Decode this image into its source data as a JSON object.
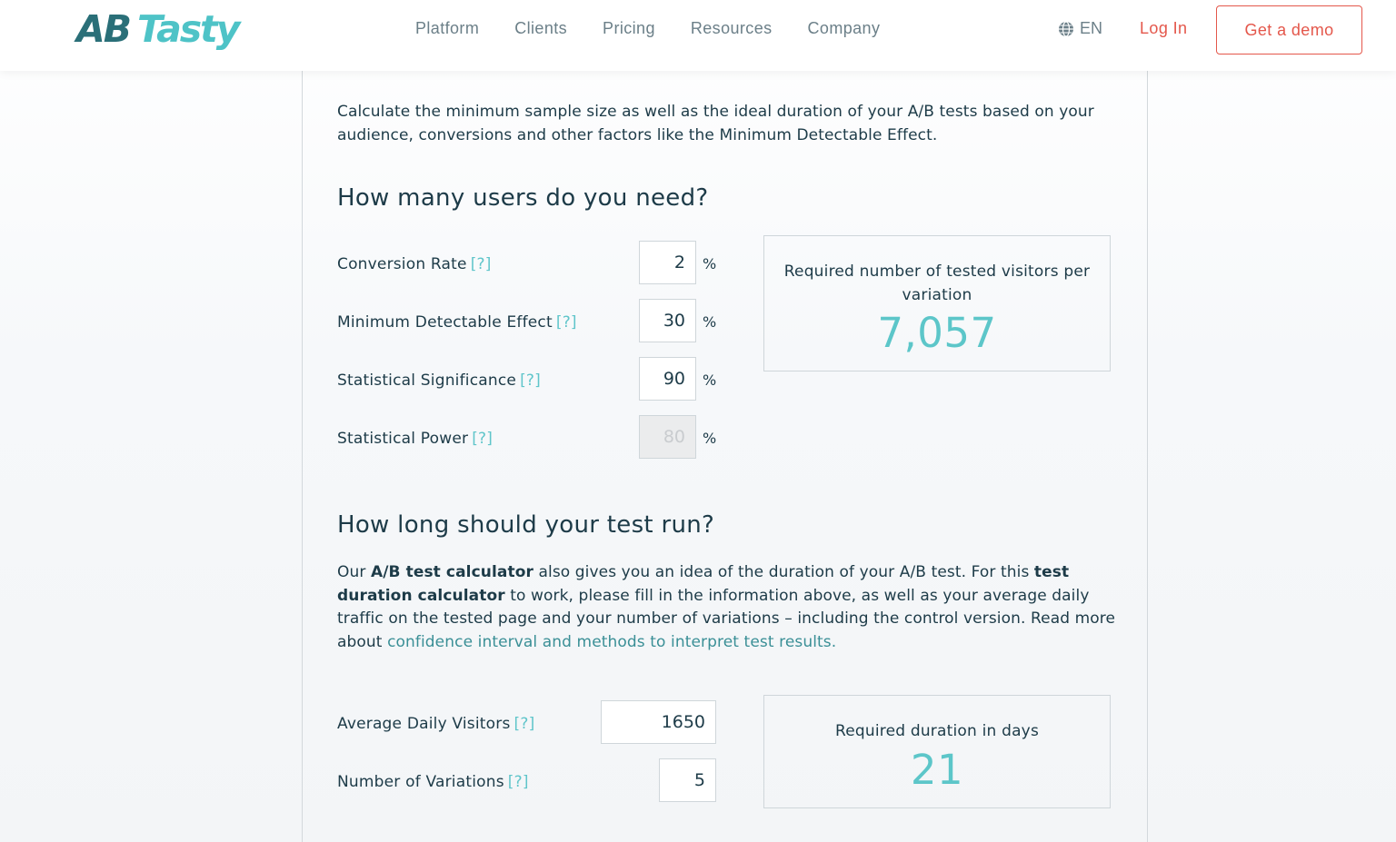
{
  "header": {
    "logo": {
      "part1": "AB",
      "part2": "Tasty"
    },
    "nav": [
      "Platform",
      "Clients",
      "Pricing",
      "Resources",
      "Company"
    ],
    "lang": "EN",
    "login": "Log In",
    "demo": "Get a demo"
  },
  "intro": "Calculate the minimum sample size as well as the ideal duration of your A/B tests based on your audience, conversions and other factors like the Minimum Detectable Effect.",
  "section1": {
    "title": "How many users do you need?",
    "fields": [
      {
        "label": "Conversion Rate",
        "help": "[?]",
        "value": "2",
        "unit": "%"
      },
      {
        "label": "Minimum Detectable Effect",
        "help": "[?]",
        "value": "30",
        "unit": "%"
      },
      {
        "label": "Statistical Significance",
        "help": "[?]",
        "value": "90",
        "unit": "%"
      },
      {
        "label": "Statistical Power",
        "help": "[?]",
        "value": "80",
        "unit": "%"
      }
    ],
    "result": {
      "label": "Required number of tested visitors per variation",
      "value": "7,057"
    }
  },
  "section2": {
    "title": "How long should your test run?",
    "para": {
      "t1": "Our ",
      "b1": "A/B test calculator",
      "t2": " also gives you an idea of the duration of your A/B test. For this ",
      "b2": "test duration calculator",
      "t3": " to work, please fill in the information above, as well as your average daily traffic on the tested page and your number of variations – including the control version. Read more about ",
      "link": "confidence interval and methods to interpret test results."
    },
    "fields": [
      {
        "label": "Average Daily Visitors",
        "help": "[?]",
        "value": "1650"
      },
      {
        "label": "Number of Variations",
        "help": "[?]",
        "value": "5"
      }
    ],
    "result": {
      "label": "Required duration in days",
      "value": "21"
    }
  },
  "colors": {
    "accent": "#5cc6c9",
    "cta": "#e4574b",
    "text": "#1d3b48",
    "brand_dark": "#2a6f78"
  },
  "icons": {
    "language": "globe-icon"
  }
}
